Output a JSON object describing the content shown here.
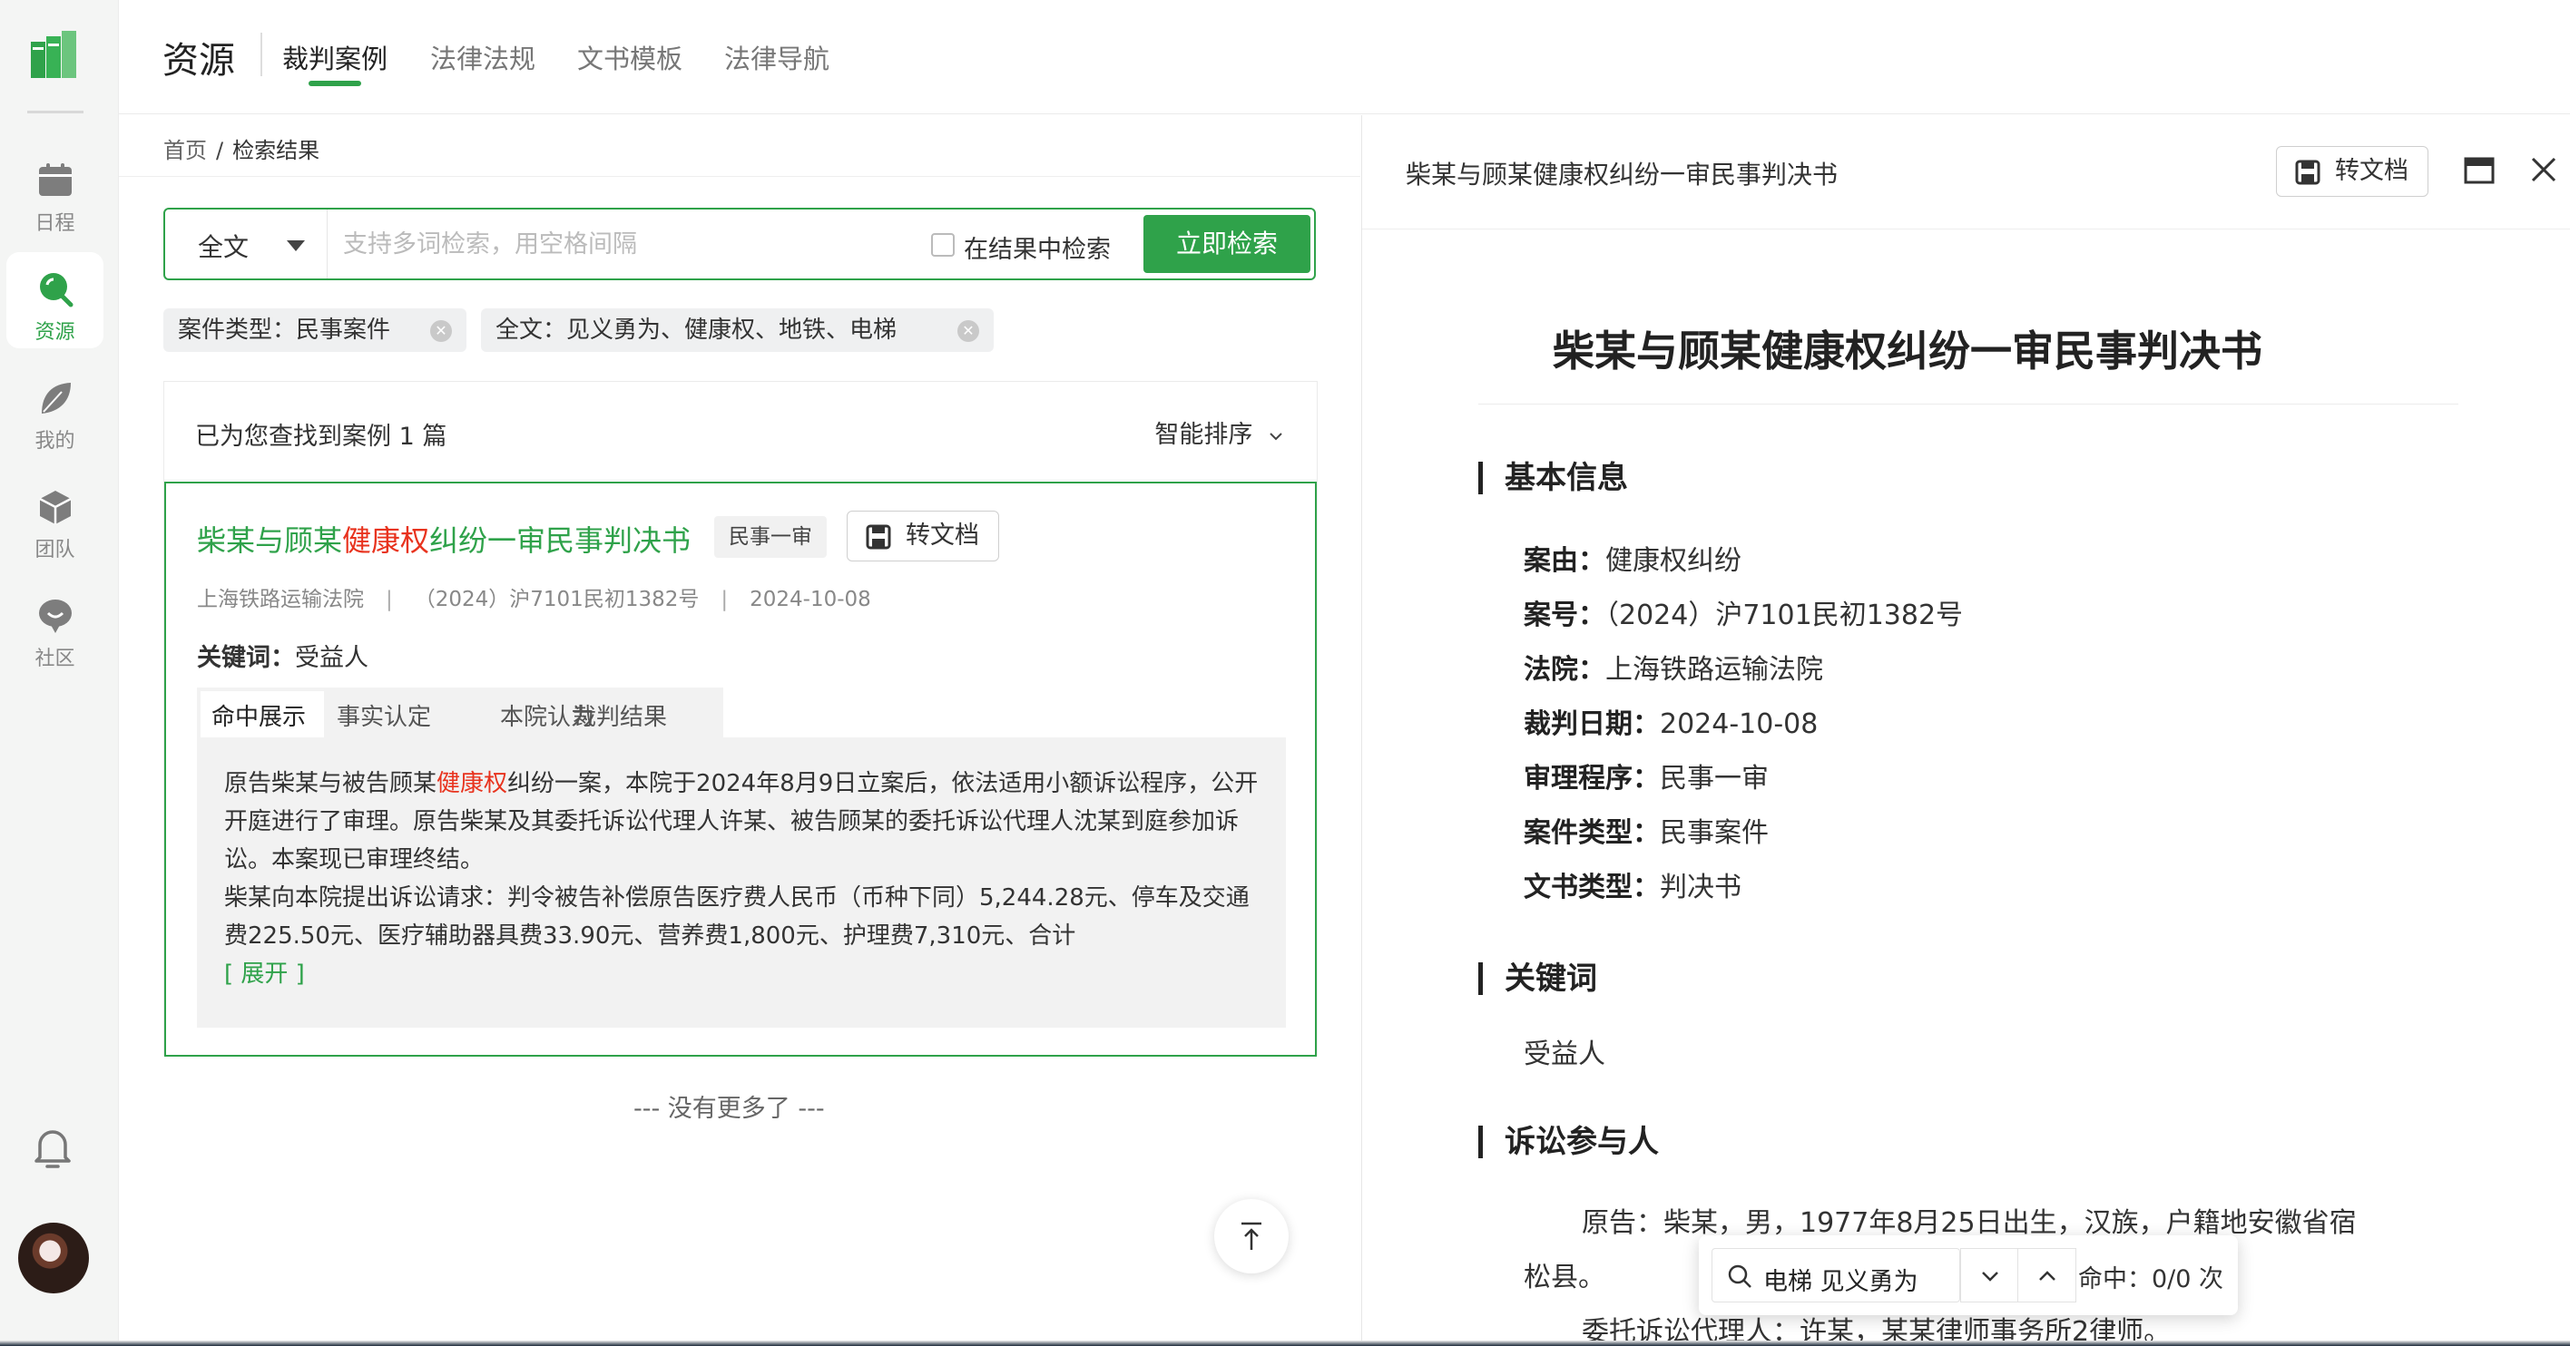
{
  "rail": {
    "items": [
      {
        "label": "日程",
        "icon": "calendar-icon"
      },
      {
        "label": "资源",
        "icon": "search-icon"
      },
      {
        "label": "我的",
        "icon": "leaf-icon"
      },
      {
        "label": "团队",
        "icon": "cube-icon"
      },
      {
        "label": "社区",
        "icon": "chat-bubble-icon"
      }
    ],
    "bell": "bell-icon"
  },
  "header": {
    "title": "资源",
    "tabs": [
      "裁判案例",
      "法律法规",
      "文书模板",
      "法律导航"
    ]
  },
  "breadcrumb": {
    "home": "首页",
    "sep": "/",
    "current": "检索结果"
  },
  "search": {
    "scope": "全文",
    "placeholder": "支持多词检索，用空格间隔",
    "value": "",
    "within_results_label": "在结果中检索",
    "within_results_checked": false,
    "button": "立即检索"
  },
  "filters": [
    {
      "label": "案件类型：民事案件"
    },
    {
      "label": "全文：见义勇为、健康权、地铁、电梯"
    }
  ],
  "results": {
    "count_text": "已为您查找到案例 1 篇",
    "sort_label": "智能排序",
    "no_more": "--- 没有更多了 ---",
    "card": {
      "title_pre": "柴某与顾某",
      "title_hl": "健康权",
      "title_post": "纠纷一审民事判决书",
      "badge": "民事一审",
      "todoc": "转文档",
      "court": "上海铁路运输法院",
      "sep": "|",
      "case_no": "（2024）沪7101民初1382号",
      "date": "2024-10-08",
      "kw_label": "关键词：",
      "kw_value": "受益人",
      "tabs": [
        "命中展示",
        "事实认定",
        "本院认为",
        "裁判结果"
      ],
      "excerpt_pre": "原告柴某与被告顾某",
      "excerpt_hl": "健康权",
      "excerpt_post": "纠纷一案，本院于2024年8月9日立案后，依法适用小额诉讼程序，公开开庭进行了审理。原告柴某及其委托诉讼代理人许某、被告顾某的委托诉讼代理人沈某到庭参加诉讼。本案现已审理终结。",
      "excerpt_p2": "柴某向本院提出诉讼请求：判令被告补偿原告医疗费人民币（币种下同）5,244.28元、停车及交通费225.50元、医疗辅助器具费33.90元、营养费1,800元、护理费7,310元、合计",
      "expand": "[ 展开 ]"
    }
  },
  "detail": {
    "header_title": "柴某与顾某健康权纠纷一审民事判决书",
    "todoc": "转文档",
    "doc_title": "柴某与顾某健康权纠纷一审民事判决书",
    "sections": {
      "basic": "基本信息",
      "keywords": "关键词",
      "parties": "诉讼参与人"
    },
    "fields": [
      {
        "k": "案由：",
        "v": "健康权纠纷"
      },
      {
        "k": "案号：",
        "v": "（2024）沪7101民初1382号"
      },
      {
        "k": "法院：",
        "v": "上海铁路运输法院"
      },
      {
        "k": "裁判日期：",
        "v": "2024-10-08"
      },
      {
        "k": "审理程序：",
        "v": "民事一审"
      },
      {
        "k": "案件类型：",
        "v": "民事案件"
      },
      {
        "k": "文书类型：",
        "v": "判决书"
      }
    ],
    "keyword": "受益人",
    "party1": "原告：柴某，男，1977年8月25日出生，汉族，户籍地安徽省宿",
    "party1b": "松县。",
    "party2": "委托诉讼代理人：许某，某某律师事务所2律师。"
  },
  "findbar": {
    "query": "电梯 见义勇为",
    "count": "命中：0/0 次"
  }
}
